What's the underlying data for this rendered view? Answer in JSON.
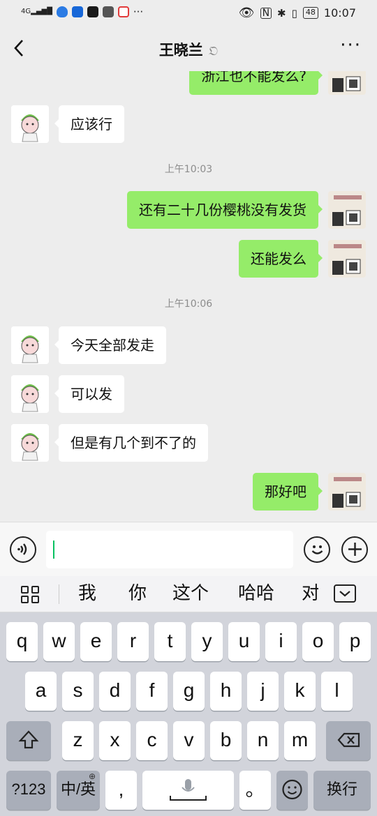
{
  "status_bar": {
    "network": "4G",
    "battery": "48",
    "time": "10:07"
  },
  "contact": {
    "name": "王晓兰",
    "ear_icon": "ear-icon"
  },
  "nav": {
    "back": "<",
    "more": "···"
  },
  "messages": [
    {
      "side": "right",
      "text": "浙江也不能发么?"
    },
    {
      "side": "left",
      "text": "应该行"
    },
    {
      "side": "time",
      "text": "上午10:03"
    },
    {
      "side": "right",
      "text": "还有二十几份樱桃没有发货"
    },
    {
      "side": "right",
      "text": "还能发么"
    },
    {
      "side": "time",
      "text": "上午10:06"
    },
    {
      "side": "left",
      "text": "今天全部发走"
    },
    {
      "side": "left",
      "text": "可以发"
    },
    {
      "side": "left",
      "text": "但是有几个到不了的"
    },
    {
      "side": "right",
      "text": "那好吧"
    }
  ],
  "input": {
    "value": ""
  },
  "suggestions": [
    "我",
    "你",
    "这个",
    "哈哈",
    "对"
  ],
  "keyboard": {
    "row1": [
      "q",
      "w",
      "e",
      "r",
      "t",
      "y",
      "u",
      "i",
      "o",
      "p"
    ],
    "row2": [
      "a",
      "s",
      "d",
      "f",
      "g",
      "h",
      "j",
      "k",
      "l"
    ],
    "row3": [
      "z",
      "x",
      "c",
      "v",
      "b",
      "n",
      "m"
    ],
    "num_key": "?123",
    "lang_key": "中/英",
    "comma": ",",
    "period": "。",
    "enter": "换行"
  },
  "colors": {
    "sent_bubble": "#95ec69",
    "received_bubble": "#ffffff",
    "background": "#ededed",
    "caret": "#07c160"
  }
}
